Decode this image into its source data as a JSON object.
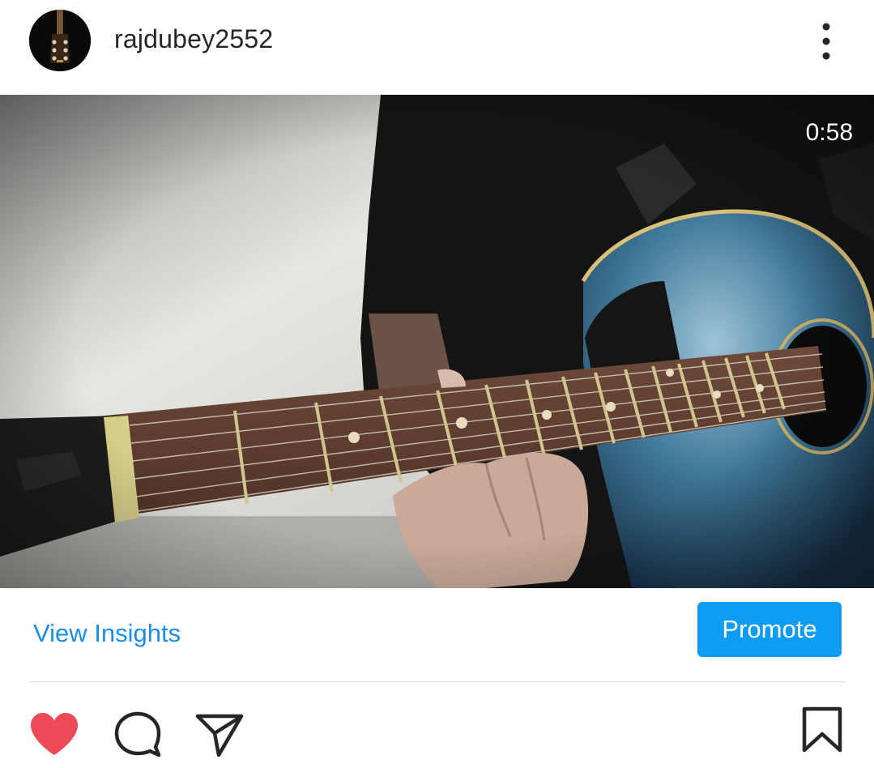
{
  "post": {
    "username": "rajdubey2552",
    "video_duration": "0:58"
  },
  "insights": {
    "view_insights_label": "View Insights",
    "promote_label": "Promote"
  },
  "icons": {
    "header": [
      "guitar-avatar",
      "more-vertical-icon"
    ],
    "actions": [
      "heart-icon",
      "comment-icon",
      "share-icon",
      "bookmark-icon"
    ]
  },
  "colors": {
    "link_blue": "#1d8ee6",
    "promote_blue": "#0e9bf2",
    "liked_heart": "#ed4956",
    "icon_dark": "#262626",
    "divider": "#dbdbdb"
  }
}
